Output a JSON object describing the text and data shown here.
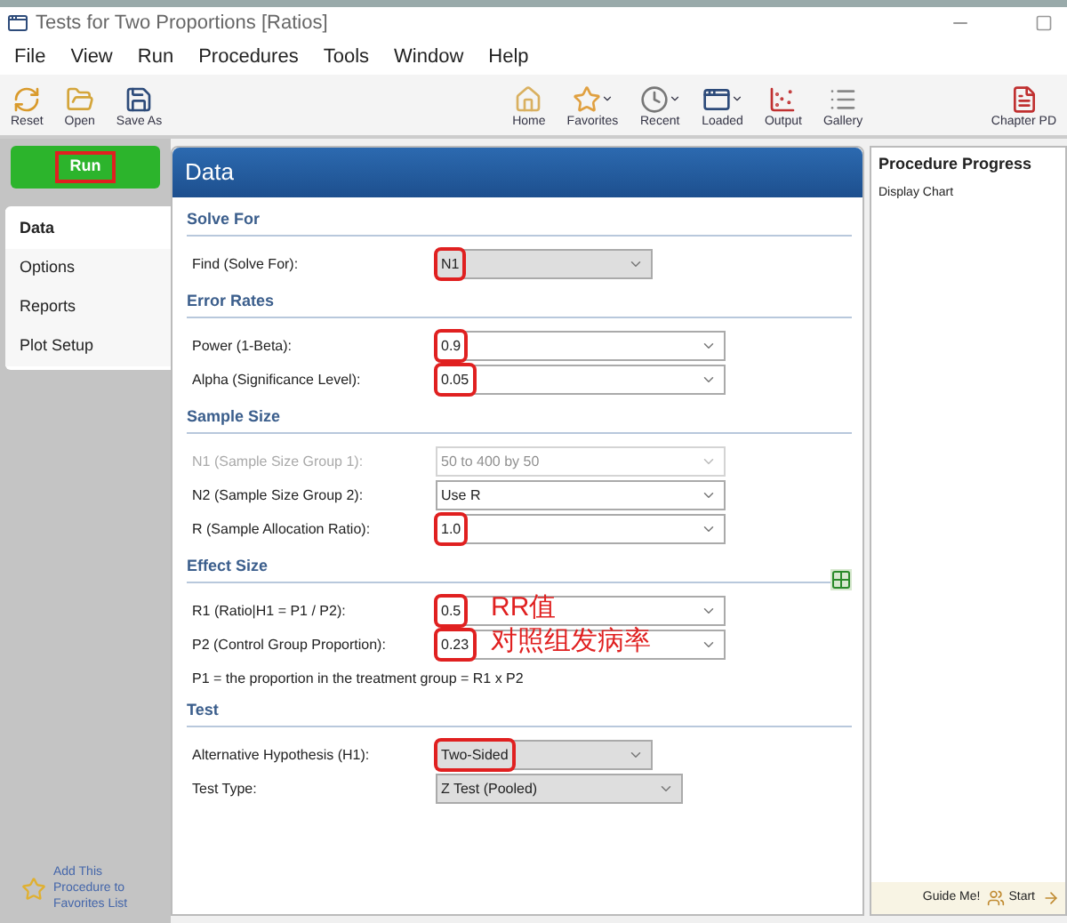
{
  "window": {
    "title": "Tests for Two Proportions [Ratios]"
  },
  "menu": [
    "File",
    "View",
    "Run",
    "Procedures",
    "Tools",
    "Window",
    "Help"
  ],
  "toolbar": [
    {
      "label": "Reset",
      "kind": "reset",
      "has_menu": false
    },
    {
      "label": "Open",
      "kind": "open",
      "has_menu": false
    },
    {
      "label": "Save As",
      "kind": "save",
      "has_menu": false
    },
    {
      "label": "Home",
      "kind": "home",
      "has_menu": false
    },
    {
      "label": "Favorites",
      "kind": "favorites",
      "has_menu": true
    },
    {
      "label": "Recent",
      "kind": "recent",
      "has_menu": true
    },
    {
      "label": "Loaded",
      "kind": "loaded",
      "has_menu": true
    },
    {
      "label": "Output",
      "kind": "output",
      "has_menu": false
    },
    {
      "label": "Gallery",
      "kind": "gallery",
      "has_menu": false
    },
    {
      "label": "Chapter PD",
      "kind": "pdf",
      "has_menu": false
    }
  ],
  "run_button": {
    "label": "Run",
    "highlighted": true
  },
  "nav_tabs": [
    {
      "label": "Data",
      "selected": true
    },
    {
      "label": "Options",
      "selected": false
    },
    {
      "label": "Reports",
      "selected": false
    },
    {
      "label": "Plot Setup",
      "selected": false
    }
  ],
  "favorites_link": "Add This Procedure to Favorites List",
  "panel": {
    "title": "Data",
    "sections": [
      {
        "title": "Solve For",
        "rows": [
          {
            "label": "Find (Solve For):",
            "value": "N1",
            "kind": "dropdown",
            "disabled": false,
            "highlighted": true
          }
        ]
      },
      {
        "title": "Error Rates",
        "rows": [
          {
            "label": "Power (1-Beta):",
            "value": "0.9",
            "kind": "combo",
            "disabled": false,
            "highlighted": true
          },
          {
            "label": "Alpha (Significance Level):",
            "value": "0.05",
            "kind": "combo",
            "disabled": false,
            "highlighted": true
          }
        ]
      },
      {
        "title": "Sample Size",
        "rows": [
          {
            "label": "N1 (Sample Size Group 1):",
            "value": "50 to 400 by 50",
            "kind": "combo",
            "disabled": true,
            "highlighted": false
          },
          {
            "label": "N2 (Sample Size Group 2):",
            "value": "Use R",
            "kind": "combo",
            "disabled": false,
            "highlighted": false
          },
          {
            "label": "R (Sample Allocation Ratio):",
            "value": "1.0",
            "kind": "combo",
            "disabled": false,
            "highlighted": true
          }
        ]
      },
      {
        "title": "Effect Size",
        "rows": [
          {
            "label": "R1 (Ratio|H1 = P1 / P2):",
            "value": "0.5",
            "kind": "combo",
            "disabled": false,
            "highlighted": true,
            "annotation": "RR值"
          },
          {
            "label": "P2 (Control Group Proportion):",
            "value": "0.23",
            "kind": "combo",
            "disabled": false,
            "highlighted": true,
            "annotation": "对照组发病率"
          }
        ],
        "note": "P1 = the proportion in the treatment group = R1 x P2"
      },
      {
        "title": "Test",
        "rows": [
          {
            "label": "Alternative Hypothesis (H1):",
            "value": "Two-Sided",
            "kind": "dropdown",
            "disabled": false,
            "highlighted": true
          },
          {
            "label": "Test Type:",
            "value": "Z Test (Pooled)",
            "kind": "wide_dropdown",
            "disabled": false,
            "highlighted": false
          }
        ]
      }
    ]
  },
  "progress": {
    "title": "Procedure Progress",
    "item": "Display Chart",
    "footer": [
      {
        "label": "Guide Me!",
        "kind": "guide"
      },
      {
        "label": "Start",
        "kind": "start"
      },
      {
        "kind": "next"
      }
    ]
  }
}
